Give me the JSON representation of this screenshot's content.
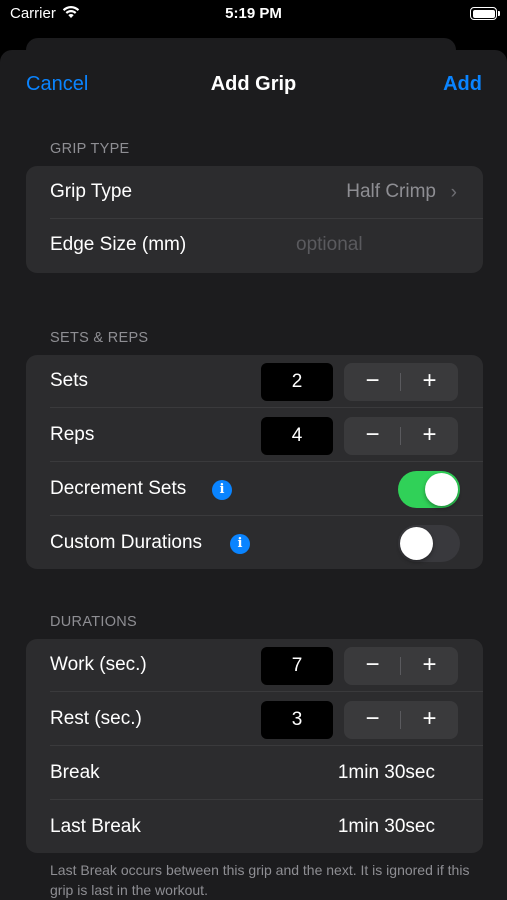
{
  "status_bar": {
    "carrier": "Carrier",
    "time": "5:19 PM"
  },
  "nav": {
    "cancel": "Cancel",
    "title": "Add Grip",
    "add": "Add"
  },
  "grip_type_section": {
    "header": "GRIP TYPE",
    "grip_type_label": "Grip Type",
    "grip_type_value": "Half Crimp",
    "edge_size_label": "Edge Size (mm)",
    "edge_size_placeholder": "optional"
  },
  "sets_reps_section": {
    "header": "SETS & REPS",
    "sets_label": "Sets",
    "sets_value": "2",
    "reps_label": "Reps",
    "reps_value": "4",
    "decrement_sets_label": "Decrement Sets",
    "decrement_sets_on": true,
    "custom_durations_label": "Custom Durations",
    "custom_durations_on": false
  },
  "durations_section": {
    "header": "DURATIONS",
    "work_label": "Work (sec.)",
    "work_value": "7",
    "rest_label": "Rest (sec.)",
    "rest_value": "3",
    "break_label": "Break",
    "break_value": "1min 30sec",
    "last_break_label": "Last Break",
    "last_break_value": "1min 30sec",
    "footnote": "Last Break occurs between this grip and the next. It is ignored if this grip is last in the workout."
  },
  "stepper": {
    "minus": "−",
    "plus": "+"
  },
  "icons": {
    "info": "i",
    "chevron": "›"
  },
  "colors": {
    "accent": "#0a84ff",
    "toggle_on": "#30d158",
    "background": "#1c1c1e",
    "cell": "#2c2c2e"
  }
}
